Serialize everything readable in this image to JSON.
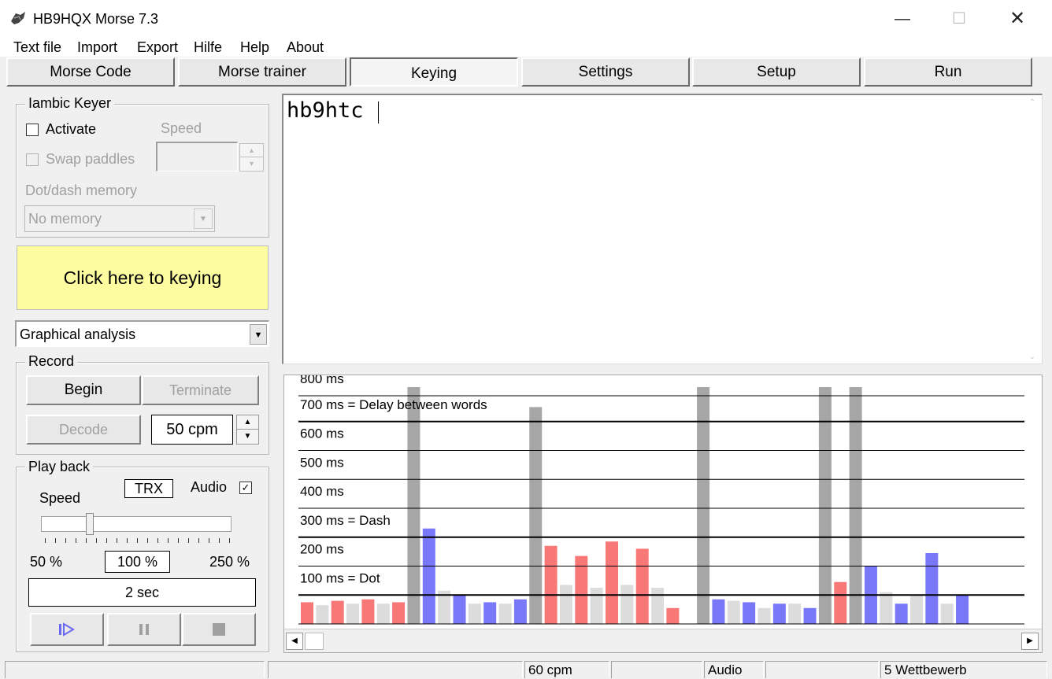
{
  "window": {
    "title": "HB9HQX Morse 7.3"
  },
  "menu": [
    "Text file",
    "Import",
    "Export",
    "Hilfe",
    "Help",
    "About"
  ],
  "tabs": [
    {
      "label": "Morse Code"
    },
    {
      "label": "Morse trainer"
    },
    {
      "label": "Keying",
      "active": true
    },
    {
      "label": "Settings"
    },
    {
      "label": "Setup"
    },
    {
      "label": "Run"
    }
  ],
  "keyer": {
    "group_label": "Iambic Keyer",
    "activate_label": "Activate",
    "activate_checked": false,
    "speed_label": "Speed",
    "swap_label": "Swap paddles",
    "memory_label": "Dot/dash memory",
    "memory_value": "No memory"
  },
  "keying_button": "Click here to keying",
  "analysis_select": "Graphical analysis",
  "record": {
    "group_label": "Record",
    "begin": "Begin",
    "terminate": "Terminate",
    "decode": "Decode",
    "speed_value": "50 cpm"
  },
  "playback": {
    "group_label": "Play back",
    "trx": "TRX",
    "audio_label": "Audio",
    "audio_checked": true,
    "speed_label": "Speed",
    "min": "50 %",
    "current": "100 %",
    "max": "250 %",
    "slider_fraction": 0.25,
    "duration": "2 sec"
  },
  "editor_text": "hb9htc",
  "chart_data": {
    "type": "bar",
    "ylabel_unit": "ms",
    "ylim": [
      0,
      800
    ],
    "gridlines": [
      {
        "value": 800,
        "label": "800 ms",
        "bold": false
      },
      {
        "value": 700,
        "label": "700 ms = Delay between words",
        "bold": true
      },
      {
        "value": 600,
        "label": "600 ms",
        "bold": false
      },
      {
        "value": 500,
        "label": "500 ms",
        "bold": false
      },
      {
        "value": 400,
        "label": "400 ms",
        "bold": false
      },
      {
        "value": 300,
        "label": "300 ms = Dash",
        "bold": true
      },
      {
        "value": 200,
        "label": "200 ms",
        "bold": false
      },
      {
        "value": 100,
        "label": "100 ms = Dot",
        "bold": true
      }
    ],
    "colors": {
      "red": "#f87878",
      "blue": "#7878f8",
      "light": "#dcdcdc",
      "gray": "#a6a6a6"
    },
    "bars": [
      {
        "c": "red",
        "v": 75
      },
      {
        "c": "light",
        "v": 65
      },
      {
        "c": "red",
        "v": 80
      },
      {
        "c": "light",
        "v": 70
      },
      {
        "c": "red",
        "v": 85
      },
      {
        "c": "light",
        "v": 70
      },
      {
        "c": "red",
        "v": 75
      },
      {
        "c": "gray",
        "v": 820
      },
      {
        "c": "blue",
        "v": 330
      },
      {
        "c": "light",
        "v": 115
      },
      {
        "c": "blue",
        "v": 100
      },
      {
        "c": "light",
        "v": 70
      },
      {
        "c": "blue",
        "v": 75
      },
      {
        "c": "light",
        "v": 70
      },
      {
        "c": "blue",
        "v": 85
      },
      {
        "c": "gray",
        "v": 750
      },
      {
        "c": "red",
        "v": 270
      },
      {
        "c": "light",
        "v": 135
      },
      {
        "c": "red",
        "v": 235
      },
      {
        "c": "light",
        "v": 125
      },
      {
        "c": "red",
        "v": 285
      },
      {
        "c": "light",
        "v": 135
      },
      {
        "c": "red",
        "v": 260
      },
      {
        "c": "light",
        "v": 125
      },
      {
        "c": "red",
        "v": 55
      },
      {
        "c": "light",
        "v": 0
      },
      {
        "c": "gray",
        "v": 820
      },
      {
        "c": "blue",
        "v": 85
      },
      {
        "c": "light",
        "v": 80
      },
      {
        "c": "blue",
        "v": 75
      },
      {
        "c": "light",
        "v": 55
      },
      {
        "c": "blue",
        "v": 70
      },
      {
        "c": "light",
        "v": 70
      },
      {
        "c": "blue",
        "v": 55
      },
      {
        "c": "gray",
        "v": 820
      },
      {
        "c": "red",
        "v": 145
      },
      {
        "c": "gray",
        "v": 820
      },
      {
        "c": "blue",
        "v": 200
      },
      {
        "c": "light",
        "v": 110
      },
      {
        "c": "blue",
        "v": 70
      },
      {
        "c": "light",
        "v": 100
      },
      {
        "c": "blue",
        "v": 245
      },
      {
        "c": "light",
        "v": 70
      },
      {
        "c": "blue",
        "v": 100
      }
    ]
  },
  "status": [
    "",
    "",
    "60 cpm",
    "",
    "Audio",
    "",
    "5 Wettbewerb"
  ]
}
